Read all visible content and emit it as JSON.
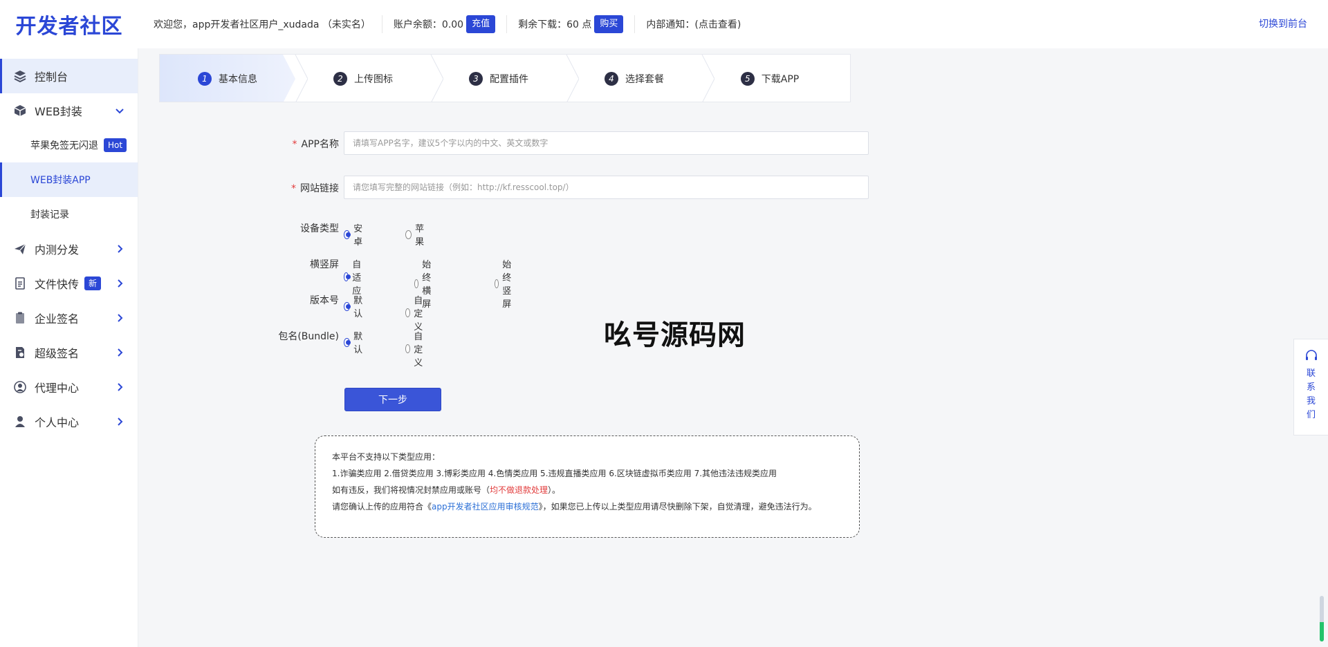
{
  "header": {
    "logo": "开发者社区",
    "welcome": "欢迎您，app开发者社区用户_xudada （未实名）",
    "balance_label": "账户余额：0.00",
    "recharge_btn": "充值",
    "downloads_label": "剩余下载：60 点",
    "buy_btn": "购买",
    "notice_label": "内部通知：(点击查看)",
    "switch_label": "切换到前台"
  },
  "sidebar": {
    "items": [
      {
        "label": "控制台",
        "icon": "layers-icon"
      },
      {
        "label": "WEB封装",
        "icon": "box-icon"
      },
      {
        "label": "苹果免签无闪退",
        "badge": "Hot"
      },
      {
        "label": "WEB封装APP"
      },
      {
        "label": "封装记录"
      },
      {
        "label": "内测分发",
        "icon": "paper-plane-icon"
      },
      {
        "label": "文件快传",
        "badge": "新",
        "icon": "file-transfer-icon"
      },
      {
        "label": "企业签名",
        "icon": "clipboard-icon"
      },
      {
        "label": "超级签名",
        "icon": "document-badge-icon"
      },
      {
        "label": "代理中心",
        "icon": "agent-icon"
      },
      {
        "label": "个人中心",
        "icon": "user-icon"
      }
    ]
  },
  "steps": [
    {
      "num": "1",
      "label": "基本信息"
    },
    {
      "num": "2",
      "label": "上传图标"
    },
    {
      "num": "3",
      "label": "配置插件"
    },
    {
      "num": "4",
      "label": "选择套餐"
    },
    {
      "num": "5",
      "label": "下载APP"
    }
  ],
  "form": {
    "app_name_label": "APP名称",
    "app_name_placeholder": "请填写APP名字，建议5个字以内的中文、英文或数字",
    "site_label": "网站链接",
    "site_placeholder": "请您填写完整的网站链接（例如：http://kf.resscool.top/）",
    "device_label": "设备类型",
    "device_options": [
      "安卓",
      "苹果"
    ],
    "device_selected": "安卓",
    "orientation_label": "横竖屏",
    "orientation_options": [
      "自适应",
      "始终横屏",
      "始终竖屏"
    ],
    "orientation_selected": "自适应",
    "version_label": "版本号",
    "version_options": [
      "默认",
      "自定义"
    ],
    "version_selected": "默认",
    "bundle_label": "包名(Bundle)",
    "bundle_options": [
      "默认",
      "自定义"
    ],
    "bundle_selected": "默认",
    "next_btn": "下一步"
  },
  "notice": {
    "line1": "本平台不支持以下类型应用：",
    "line2": "1.诈骗类应用 2.借贷类应用 3.博彩类应用 4.色情类应用 5.违规直播类应用 6.区块链虚拟币类应用 7.其他违法违规类应用",
    "line3_a": "如有违反，我们将视情况封禁应用或账号（",
    "line3_red": "均不做退款处理",
    "line3_b": "）。",
    "line4_a": "请您确认上传的应用符合《",
    "line4_link": "app开发者社区应用审核规范",
    "line4_b": "》，如果您已上传以上类型应用请尽快删除下架，自觉清理，避免违法行为。"
  },
  "watermark": "吆号源码网",
  "contact": {
    "label": "联系我们",
    "icon": "headset-icon"
  },
  "colors": {
    "accent": "#2b47d6",
    "required": "#e23c3c"
  }
}
